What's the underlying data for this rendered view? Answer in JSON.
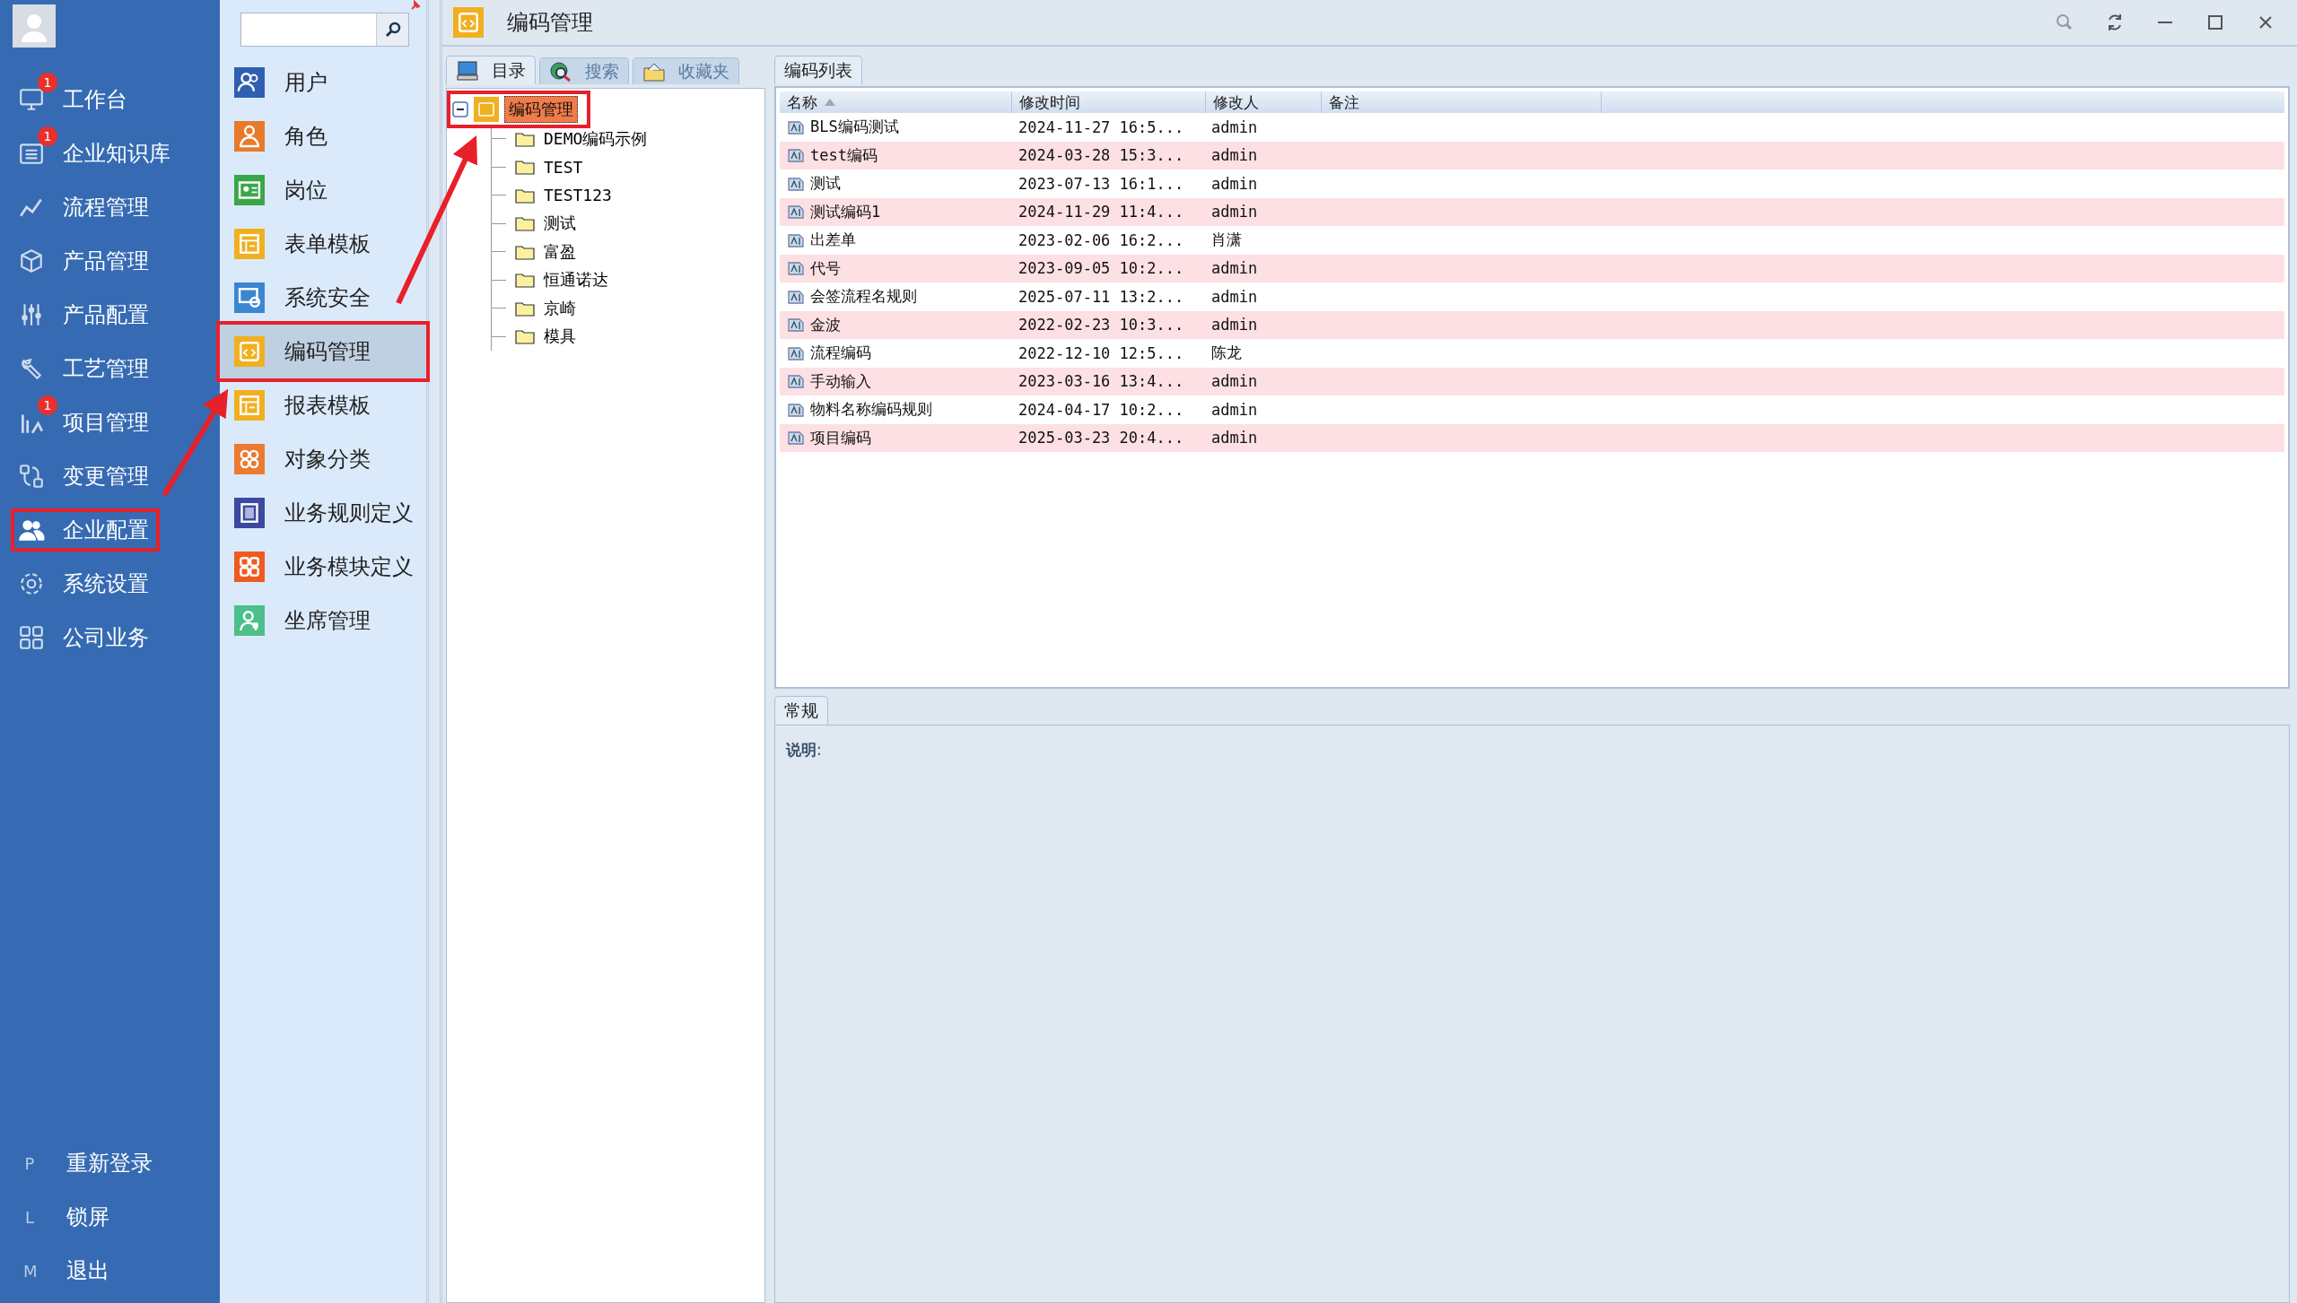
{
  "sidebar": {
    "items": [
      {
        "label": "工作台",
        "badge": "1",
        "marked": false
      },
      {
        "label": "企业知识库",
        "badge": "1",
        "marked": false
      },
      {
        "label": "流程管理",
        "marked": false
      },
      {
        "label": "产品管理",
        "marked": false
      },
      {
        "label": "产品配置",
        "marked": false
      },
      {
        "label": "工艺管理",
        "marked": false
      },
      {
        "label": "项目管理",
        "badge": "1",
        "marked": false
      },
      {
        "label": "变更管理",
        "marked": false
      },
      {
        "label": "企业配置",
        "marked": true
      },
      {
        "label": "系统设置",
        "marked": false
      },
      {
        "label": "公司业务",
        "marked": false
      }
    ],
    "footer_items": [
      {
        "key": "P",
        "label": "重新登录"
      },
      {
        "key": "L",
        "label": "锁屏"
      },
      {
        "key": "M",
        "label": "退出"
      }
    ]
  },
  "menu": {
    "items": [
      {
        "label": "用户",
        "color": "#2f5fb0",
        "selected": false,
        "marked": false
      },
      {
        "label": "角色",
        "color": "#e87a2a",
        "selected": false,
        "marked": false
      },
      {
        "label": "岗位",
        "color": "#3aa64a",
        "selected": false,
        "marked": false
      },
      {
        "label": "表单模板",
        "color": "#f0b020",
        "selected": false,
        "marked": false
      },
      {
        "label": "系统安全",
        "color": "#3b86d0",
        "selected": false,
        "marked": false
      },
      {
        "label": "编码管理",
        "color": "#f0b020",
        "selected": true,
        "marked": true
      },
      {
        "label": "报表模板",
        "color": "#f0b021",
        "selected": false,
        "marked": false
      },
      {
        "label": "对象分类",
        "color": "#ec7a30",
        "selected": false,
        "marked": false
      },
      {
        "label": "业务规则定义",
        "color": "#3b4aa0",
        "selected": false,
        "marked": false
      },
      {
        "label": "业务模块定义",
        "color": "#f05a20",
        "selected": false,
        "marked": false
      },
      {
        "label": "坐席管理",
        "color": "#4cbf8a",
        "selected": false,
        "marked": false
      }
    ]
  },
  "window": {
    "title": "编码管理"
  },
  "left_tabs": [
    {
      "label": "目录",
      "selected": true
    },
    {
      "label": "搜索",
      "selected": false
    },
    {
      "label": "收藏夹",
      "selected": false
    }
  ],
  "tree": {
    "label": "编码管理",
    "expanded": true,
    "selected": true,
    "marked": true,
    "children": [
      {
        "label": "DEMO编码示例"
      },
      {
        "label": "TEST"
      },
      {
        "label": "TEST123"
      },
      {
        "label": "测试"
      },
      {
        "label": "富盈"
      },
      {
        "label": "恒通诺达"
      },
      {
        "label": "京崎"
      },
      {
        "label": "模具"
      }
    ]
  },
  "list_tabs": [
    {
      "label": "编码列表",
      "selected": true
    }
  ],
  "table": {
    "columns": [
      {
        "label": "名称",
        "sorted": true
      },
      {
        "label": "修改时间",
        "sorted": false
      },
      {
        "label": "修改人",
        "sorted": false
      },
      {
        "label": "备注",
        "sorted": false
      }
    ],
    "rows": [
      [
        "BLS编码测试",
        "2024-11-27 16:5...",
        "admin"
      ],
      [
        "test编码",
        "2024-03-28 15:3...",
        "admin"
      ],
      [
        "测试",
        "2023-07-13 16:1...",
        "admin"
      ],
      [
        "测试编码1",
        "2024-11-29 11:4...",
        "admin"
      ],
      [
        "出差单",
        "2023-02-06 16:2...",
        "肖潇"
      ],
      [
        "代号",
        "2023-09-05 10:2...",
        "admin"
      ],
      [
        "会签流程名规则",
        "2025-07-11 13:2...",
        "admin"
      ],
      [
        "金波",
        "2022-02-23 10:3...",
        "admin"
      ],
      [
        "流程编码",
        "2022-12-10 12:5...",
        "陈龙"
      ],
      [
        "手动输入",
        "2023-03-16 13:4...",
        "admin"
      ],
      [
        "物料名称编码规则",
        "2024-04-17 10:2...",
        "admin"
      ],
      [
        "项目编码",
        "2025-03-23 20:4...",
        "admin"
      ]
    ]
  },
  "detail": {
    "tabs": [
      {
        "label": "常规",
        "selected": true
      }
    ],
    "fields": [
      {
        "label": "**说明**:"
      }
    ]
  }
}
